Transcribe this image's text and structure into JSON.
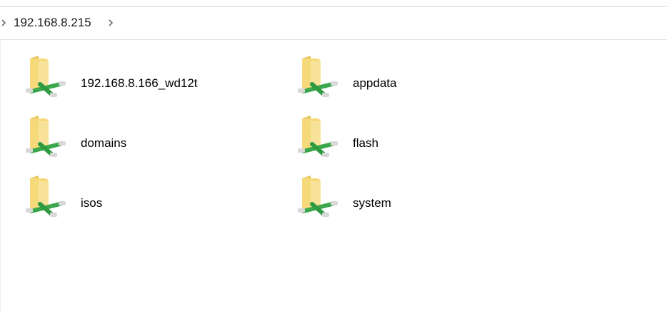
{
  "address_bar": {
    "path": "192.168.8.215"
  },
  "items": [
    {
      "name": "192.168.8.166_wd12t",
      "icon": "network-folder-icon"
    },
    {
      "name": "appdata",
      "icon": "network-folder-icon"
    },
    {
      "name": "domains",
      "icon": "network-folder-icon"
    },
    {
      "name": "flash",
      "icon": "network-folder-icon"
    },
    {
      "name": "isos",
      "icon": "network-folder-icon"
    },
    {
      "name": "system",
      "icon": "network-folder-icon"
    }
  ],
  "colors": {
    "folder": "#f5d97a",
    "folder_shade": "#e9c45a",
    "cable_green": "#3aa84a",
    "cable_end": "#d8d8d8"
  }
}
